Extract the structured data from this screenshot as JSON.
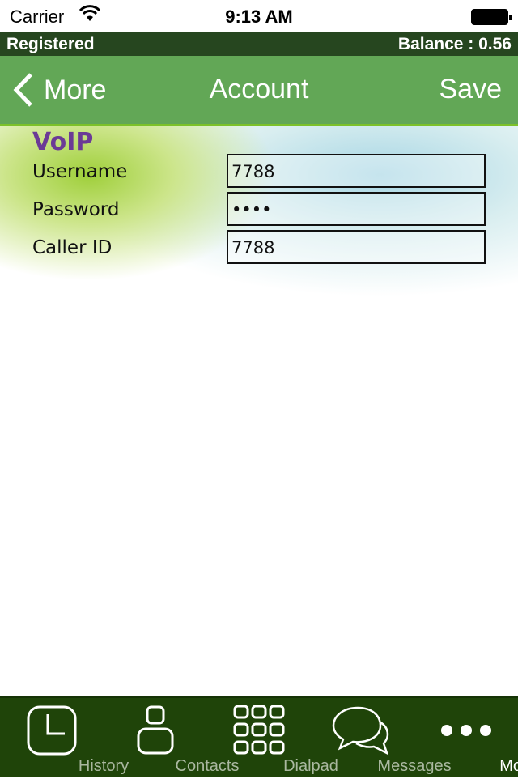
{
  "status_bar": {
    "carrier": "Carrier",
    "time": "9:13 AM"
  },
  "registration": {
    "status": "Registered",
    "balance": "Balance : 0.56"
  },
  "nav": {
    "back_label": "More",
    "title": "Account",
    "save_label": "Save"
  },
  "form": {
    "section": "VoIP",
    "fields": [
      {
        "label": "Username",
        "value": "7788"
      },
      {
        "label": "Password",
        "value": "••••"
      },
      {
        "label": "Caller ID",
        "value": "7788"
      }
    ]
  },
  "tabs": [
    {
      "label": "History",
      "icon": "clock-icon"
    },
    {
      "label": "Contacts",
      "icon": "person-icon"
    },
    {
      "label": "Dialpad",
      "icon": "dialpad-icon"
    },
    {
      "label": "Messages",
      "icon": "chat-bubbles-icon"
    },
    {
      "label": "More",
      "icon": "more-dots-icon",
      "active": true
    }
  ]
}
